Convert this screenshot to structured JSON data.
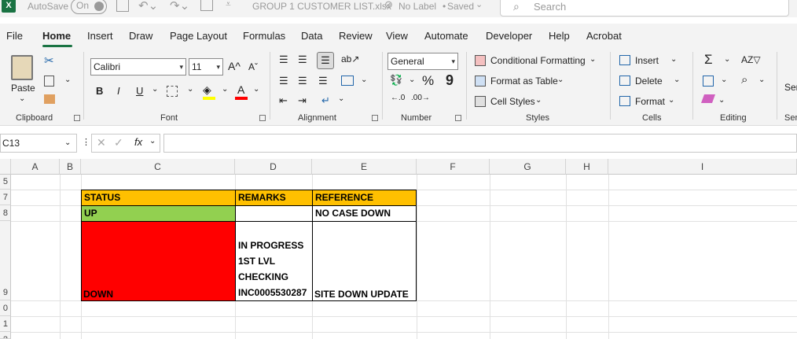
{
  "titlebar": {
    "autosave_label": "AutoSave",
    "autosave_state": "On",
    "filename": "GROUP 1 CUSTOMER LIST.xlsx",
    "label_status": "No Label",
    "save_status": "Saved",
    "search_placeholder": "Search"
  },
  "menu": {
    "tabs": [
      "File",
      "Home",
      "Insert",
      "Draw",
      "Page Layout",
      "Formulas",
      "Data",
      "Review",
      "View",
      "Automate",
      "Developer",
      "Help",
      "Acrobat"
    ],
    "active": "Home"
  },
  "ribbon": {
    "clipboard": {
      "paste": "Paste",
      "label": "Clipboard"
    },
    "font": {
      "name": "Calibri",
      "size": "11",
      "label": "Font",
      "bold": "B",
      "italic": "I",
      "underline": "U"
    },
    "alignment": {
      "label": "Alignment"
    },
    "number": {
      "format": "General",
      "label": "Number"
    },
    "styles": {
      "conditional": "Conditional Formatting",
      "format_table": "Format as Table",
      "cell_styles": "Cell Styles",
      "label": "Styles"
    },
    "cells": {
      "insert": "Insert",
      "delete": "Delete",
      "format": "Format",
      "label": "Cells"
    },
    "editing": {
      "label": "Editing"
    },
    "overflow_label": "Ser"
  },
  "formula_bar": {
    "name_box": "C13",
    "fx": "fx",
    "formula": ""
  },
  "columns": [
    "A",
    "B",
    "C",
    "D",
    "E",
    "F",
    "G",
    "H",
    "I"
  ],
  "selected_column": "C",
  "rows": [
    "5",
    "7",
    "8",
    "9",
    "0",
    "1",
    "2"
  ],
  "table": {
    "headers": [
      "STATUS",
      "REMARKS",
      "REFERENCE"
    ],
    "row1": {
      "status": "UP",
      "remarks": "",
      "reference": "NO CASE DOWN"
    },
    "row2": {
      "status": "DOWN",
      "remarks_lines": [
        "IN PROGRESS",
        "1ST LVL",
        "CHECKING",
        "INC0005530287"
      ],
      "reference": "SITE DOWN UPDATE"
    }
  },
  "colors": {
    "header_fill": "#ffc000",
    "up_fill": "#92d050",
    "down_fill": "#ff0000",
    "accent": "#1a7343"
  }
}
